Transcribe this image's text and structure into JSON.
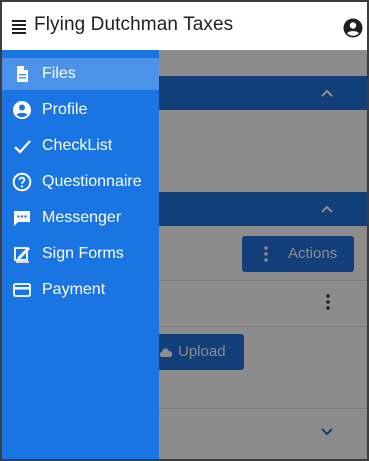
{
  "app": {
    "title": "Flying Dutchman Taxes"
  },
  "drawer": {
    "items": [
      {
        "label": "Files",
        "icon": "file-icon",
        "active": true
      },
      {
        "label": "Profile",
        "icon": "account-circle-icon",
        "active": false
      },
      {
        "label": "CheckList",
        "icon": "checkmark-icon",
        "active": false
      },
      {
        "label": "Questionnaire",
        "icon": "help-circle-icon",
        "active": false
      },
      {
        "label": "Messenger",
        "icon": "chat-icon",
        "active": false
      },
      {
        "label": "Sign Forms",
        "icon": "sign-icon",
        "active": false
      },
      {
        "label": "Payment",
        "icon": "credit-card-icon",
        "active": false
      }
    ]
  },
  "content": {
    "actions_label": "Actions",
    "upload_label": "Upload"
  },
  "colors": {
    "drawer": "#1a75e2",
    "drawer_active": "#4b92e8",
    "panel_header": "#123f7a",
    "overlay": "#8c8c8c"
  }
}
